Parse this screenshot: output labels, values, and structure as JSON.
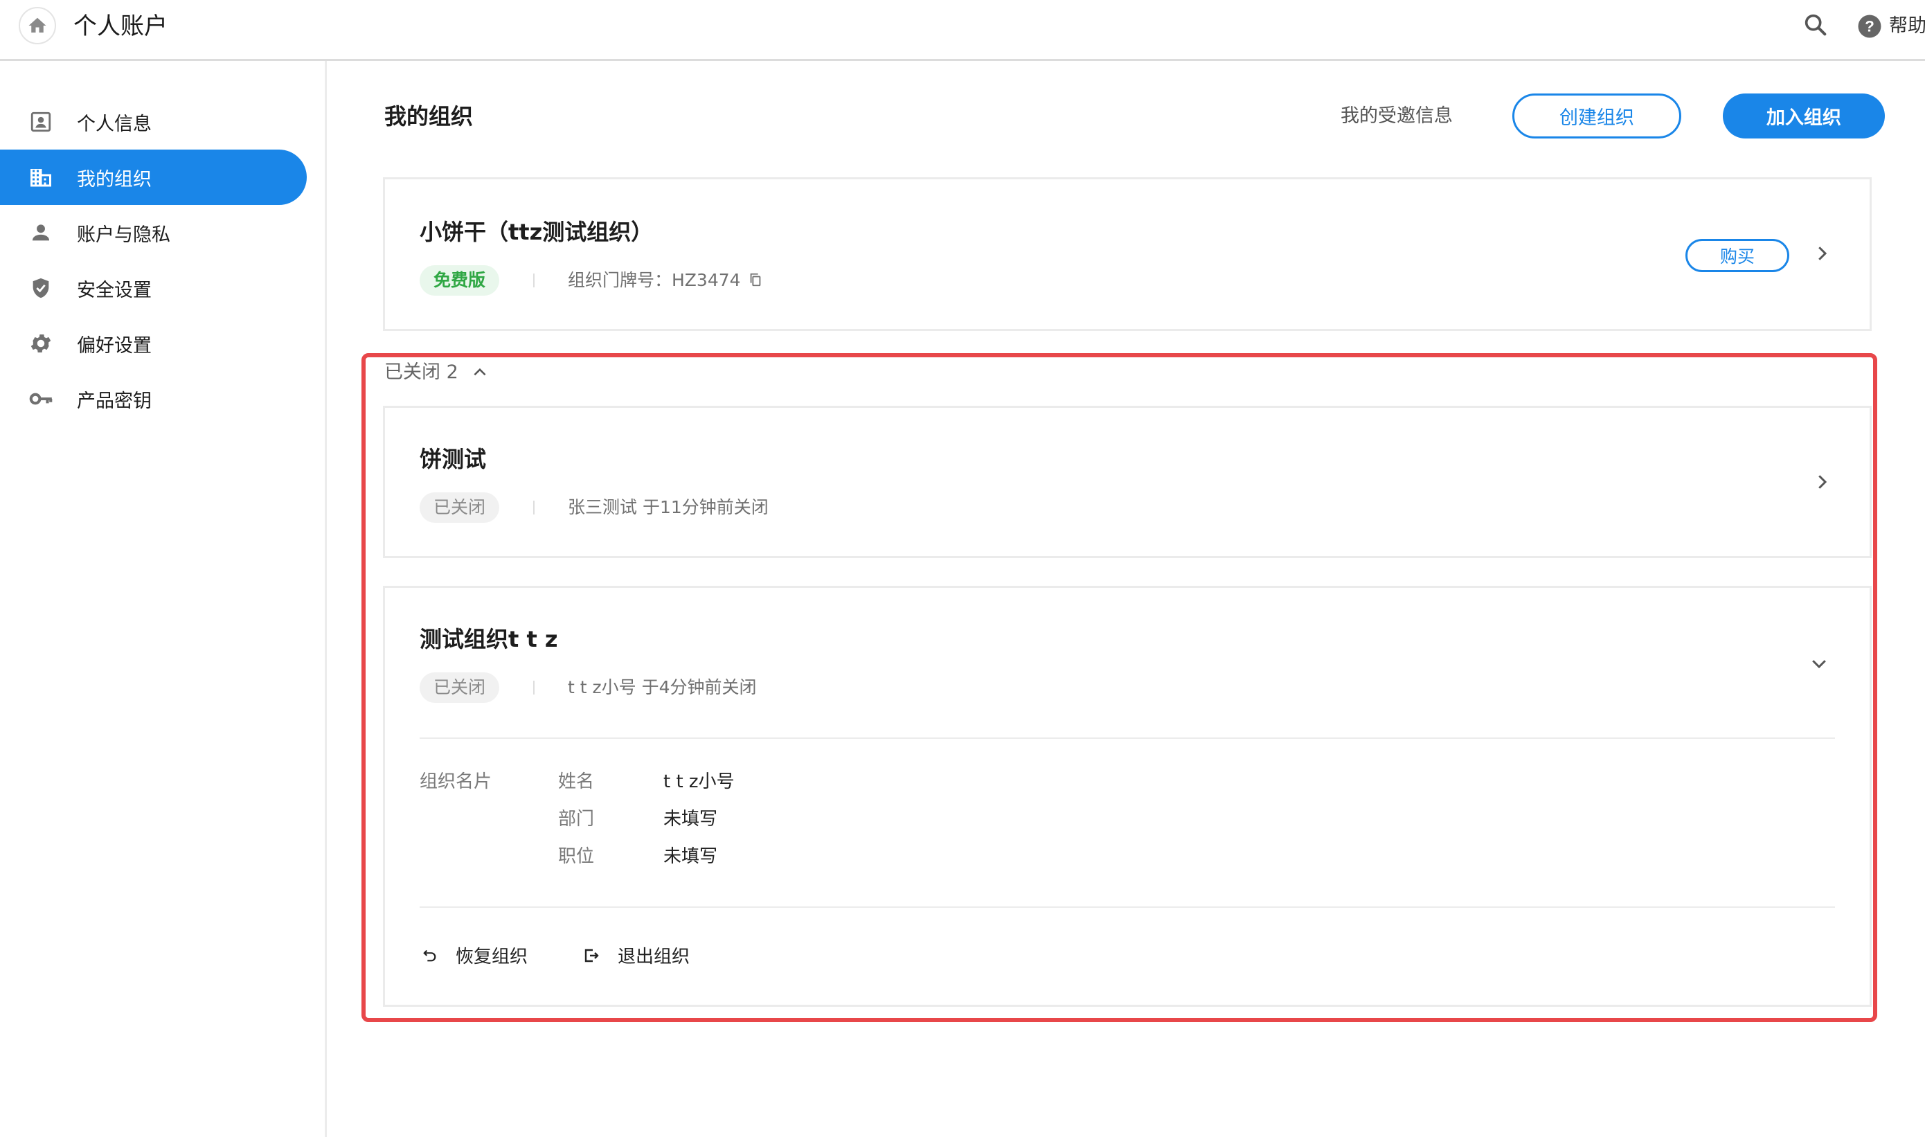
{
  "topbar": {
    "title": "个人账户",
    "help_label": "帮助"
  },
  "sidebar": {
    "items": [
      {
        "label": "个人信息",
        "icon": "person-card-icon"
      },
      {
        "label": "我的组织",
        "icon": "building-icon",
        "active": true
      },
      {
        "label": "账户与隐私",
        "icon": "person-icon"
      },
      {
        "label": "安全设置",
        "icon": "shield-icon"
      },
      {
        "label": "偏好设置",
        "icon": "gear-icon"
      },
      {
        "label": "产品密钥",
        "icon": "key-icon"
      }
    ]
  },
  "main": {
    "title": "我的组织",
    "invite_link": "我的受邀信息",
    "create_label": "创建组织",
    "join_label": "加入组织"
  },
  "active_org": {
    "name": "小饼干（ttz测试组织）",
    "tag": "免费版",
    "meta": "组织门牌号：HZ3474",
    "buy_label": "购买"
  },
  "closed_section": {
    "toggle_label": "已关闭 2",
    "orgs": [
      {
        "name": "饼测试",
        "tag": "已关闭",
        "meta": "张三测试 于11分钟前关闭"
      },
      {
        "name": "测试组织t t z",
        "tag": "已关闭",
        "meta": "t t z小号 于4分钟前关闭",
        "card_label": "组织名片",
        "fields": [
          {
            "label": "姓名",
            "value": "t t z小号"
          },
          {
            "label": "部门",
            "value": "未填写"
          },
          {
            "label": "职位",
            "value": "未填写"
          }
        ],
        "restore_label": "恢复组织",
        "leave_label": "退出组织"
      }
    ]
  },
  "colors": {
    "primary": "#1a86e8",
    "free_tag_text": "#2fa744",
    "free_tag_bg": "#e9f7ec",
    "highlight": "#e8474a"
  }
}
